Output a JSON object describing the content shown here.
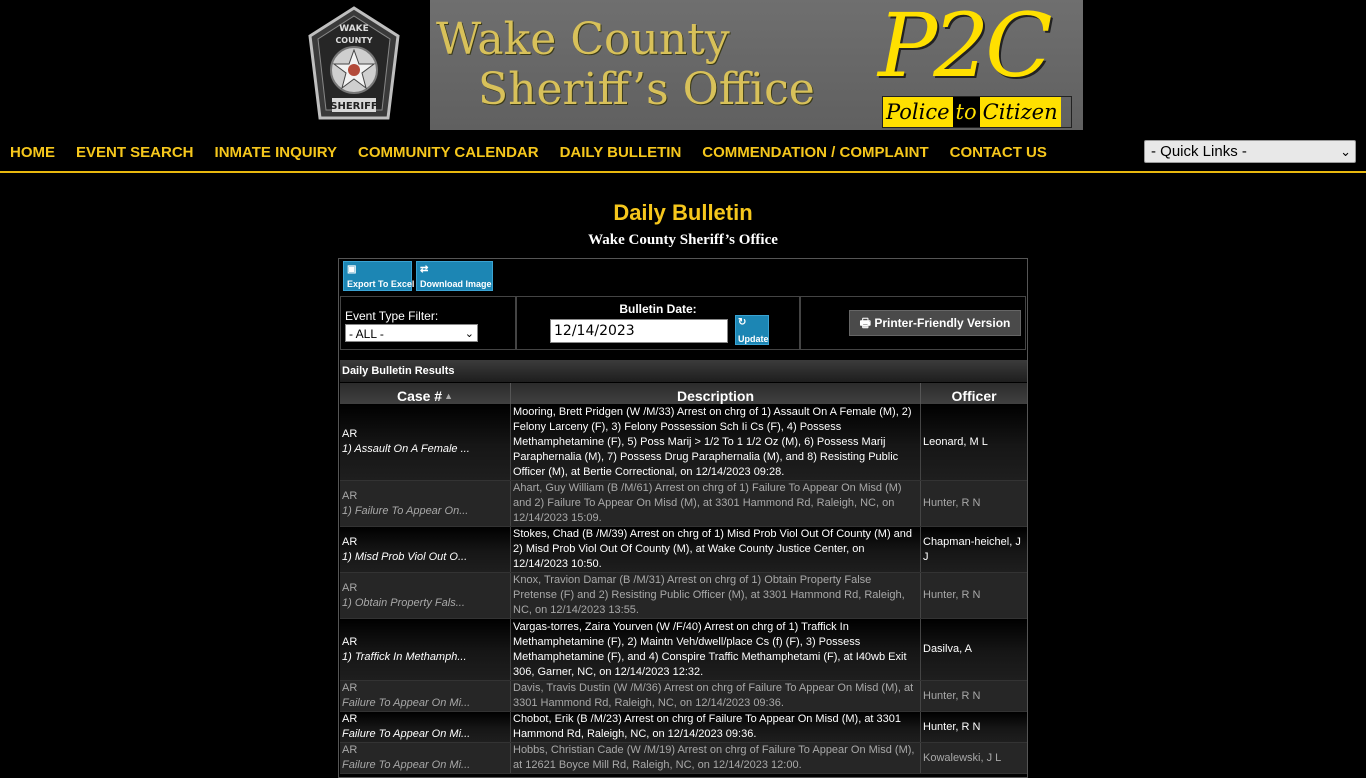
{
  "banner": {
    "badge_top": "WAKE",
    "badge_mid": "COUNTY",
    "badge_bottom": "SHERIFF",
    "title_line1": "Wake County",
    "title_line2": "Sheriff’s Office",
    "logo_text": "P2C",
    "logo_sub_police": "Police",
    "logo_sub_to": "to",
    "logo_sub_citizen": "Citizen",
    "accent": "#f6c71c"
  },
  "nav": {
    "items": [
      "HOME",
      "EVENT SEARCH",
      "INMATE INQUIRY",
      "COMMUNITY CALENDAR",
      "DAILY BULLETIN",
      "COMMENDATION / COMPLAINT",
      "CONTACT US"
    ],
    "quick_links": "- Quick Links -"
  },
  "page": {
    "title": "Daily Bulletin",
    "subtitle": "Wake County Sheriff’s Office"
  },
  "toolbar": {
    "export_label": "Export To Excel",
    "download_label": "Download Image"
  },
  "filters": {
    "event_type_label": "Event Type Filter:",
    "event_type_value": "- ALL -",
    "bulletin_date_label": "Bulletin Date:",
    "bulletin_date_value": "12/14/2023",
    "update_label": "Update",
    "printer_label": "Printer-Friendly Version"
  },
  "results": {
    "heading": "Daily Bulletin Results",
    "columns": [
      "Case #",
      "Description",
      "Officer"
    ],
    "rows": [
      {
        "type": "AR",
        "charge": "1) Assault On A Female ...",
        "description": "Mooring, Brett Pridgen (W /M/33) Arrest on chrg of 1) Assault On A Female (M), 2) Felony Larceny (F), 3) Felony Possession Sch Ii Cs (F), 4) Possess Methamphetamine (F), 5) Poss Marij > 1/2 To 1 1/2 Oz (M), 6) Possess Marij Paraphernalia (M), 7) Possess Drug Paraphernalia (M), and 8) Resisting Public Officer (M), at Bertie Correctional, on 12/14/2023 09:28.",
        "officer": "Leonard, M L"
      },
      {
        "type": "AR",
        "charge": "1) Failure To Appear On...",
        "description": "Ahart, Guy William (B /M/61) Arrest on chrg of 1) Failure To Appear On Misd (M) and 2) Failure To Appear On Misd (M), at 3301 Hammond Rd, Raleigh, NC, on 12/14/2023 15:09.",
        "officer": "Hunter, R N"
      },
      {
        "type": "AR",
        "charge": "1) Misd Prob Viol Out O...",
        "description": "Stokes, Chad (B /M/39) Arrest on chrg of 1) Misd Prob Viol Out Of County (M) and 2) Misd Prob Viol Out Of County (M), at Wake County Justice Center, on 12/14/2023 10:50.",
        "officer": "Chapman-heichel, J J"
      },
      {
        "type": "AR",
        "charge": "1) Obtain Property Fals...",
        "description": "Knox, Travion Damar (B /M/31) Arrest on chrg of 1) Obtain Property False Pretense (F) and 2) Resisting Public Officer (M), at 3301 Hammond Rd, Raleigh, NC, on 12/14/2023 13:55.",
        "officer": "Hunter, R N"
      },
      {
        "type": "AR",
        "charge": "1) Traffick In Methamph...",
        "description": "Vargas-torres, Zaira Yourven (W /F/40) Arrest on chrg of 1) Traffick In Methamphetamine (F), 2) Maintn Veh/dwell/place Cs (f) (F), 3) Possess Methamphetamine (F), and 4) Conspire Traffic Methamphetami (F), at I40wb Exit 306, Garner, NC, on 12/14/2023 12:32.",
        "officer": "Dasilva, A"
      },
      {
        "type": "AR",
        "charge": "Failure To Appear On Mi...",
        "description": "Davis, Travis Dustin (W /M/36) Arrest on chrg of Failure To Appear On Misd (M), at 3301 Hammond Rd, Raleigh, NC, on 12/14/2023 09:36.",
        "officer": "Hunter, R N"
      },
      {
        "type": "AR",
        "charge": "Failure To Appear On Mi...",
        "description": "Chobot, Erik (B /M/23) Arrest on chrg of Failure To Appear On Misd (M), at 3301 Hammond Rd, Raleigh, NC, on 12/14/2023 09:36.",
        "officer": "Hunter, R N"
      },
      {
        "type": "AR",
        "charge": "Failure To Appear On Mi...",
        "description": "Hobbs, Christian Cade (W /M/19) Arrest on chrg of Failure To Appear On Misd (M), at 12621 Boyce Mill Rd, Raleigh, NC, on 12/14/2023 12:00.",
        "officer": "Kowalewski, J L"
      }
    ]
  }
}
